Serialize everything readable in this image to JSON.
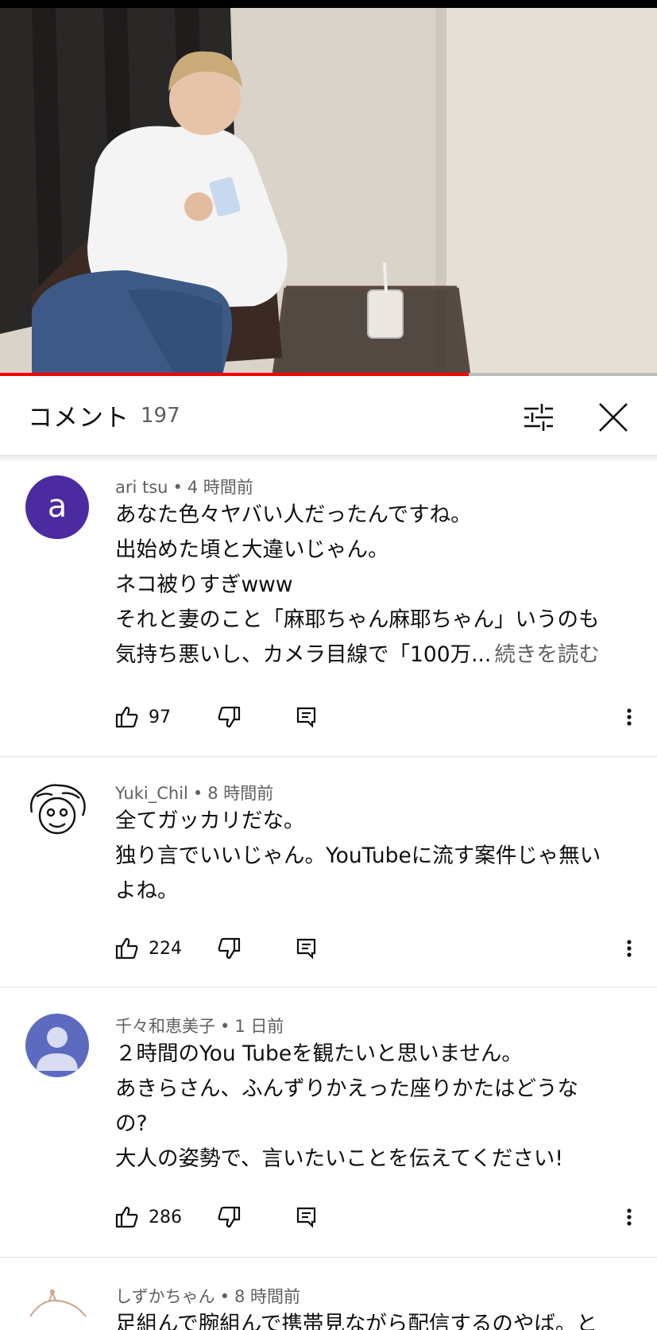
{
  "video": {
    "progress": 0.713
  },
  "header": {
    "title": "コメント",
    "count": "197"
  },
  "icons": {
    "filter": "sort-filter-icon",
    "close": "close-icon",
    "like": "thumbs-up-icon",
    "dislike": "thumbs-down-icon",
    "reply": "reply-icon",
    "more": "more-vert-icon"
  },
  "colors": {
    "accent": "#ff0000",
    "avatar_a": "#4c2aa0",
    "avatar_default": "#5c6bc0",
    "meta_text": "#606060"
  },
  "comments": [
    {
      "avatar_letter": "a",
      "author": "ari tsu",
      "time": "4 時間前",
      "lines": [
        "あなた色々ヤバい人だったんですね。",
        "出始めた頃と大違いじゃん。",
        "ネコ被りすぎwww",
        "それと妻のこと「麻耶ちゃん麻耶ちゃん」いうのも",
        "気持ち悪いし、カメラ目線で「100万..."
      ],
      "read_more": "続きを読む",
      "likes": "97"
    },
    {
      "author": "Yuki_Chil",
      "time": "8 時間前",
      "lines": [
        "全てガッカリだな。",
        "独り言でいいじゃん。YouTubeに流す案件じゃ無い",
        "よね。"
      ],
      "likes": "224"
    },
    {
      "author": "千々和恵美子",
      "time": "1 日前",
      "lines": [
        "２時間のYou Tubeを観たいと思いません。",
        "あきらさん、ふんずりかえった座りかたはどうな",
        "の?",
        "大人の姿勢で、言いたいことを伝えてください!"
      ],
      "likes": "286"
    },
    {
      "author": "しずかちゃん",
      "time": "8 時間前",
      "lines": [
        "足組んで腕組んで携帯見ながら配信するのやば。と"
      ]
    }
  ]
}
